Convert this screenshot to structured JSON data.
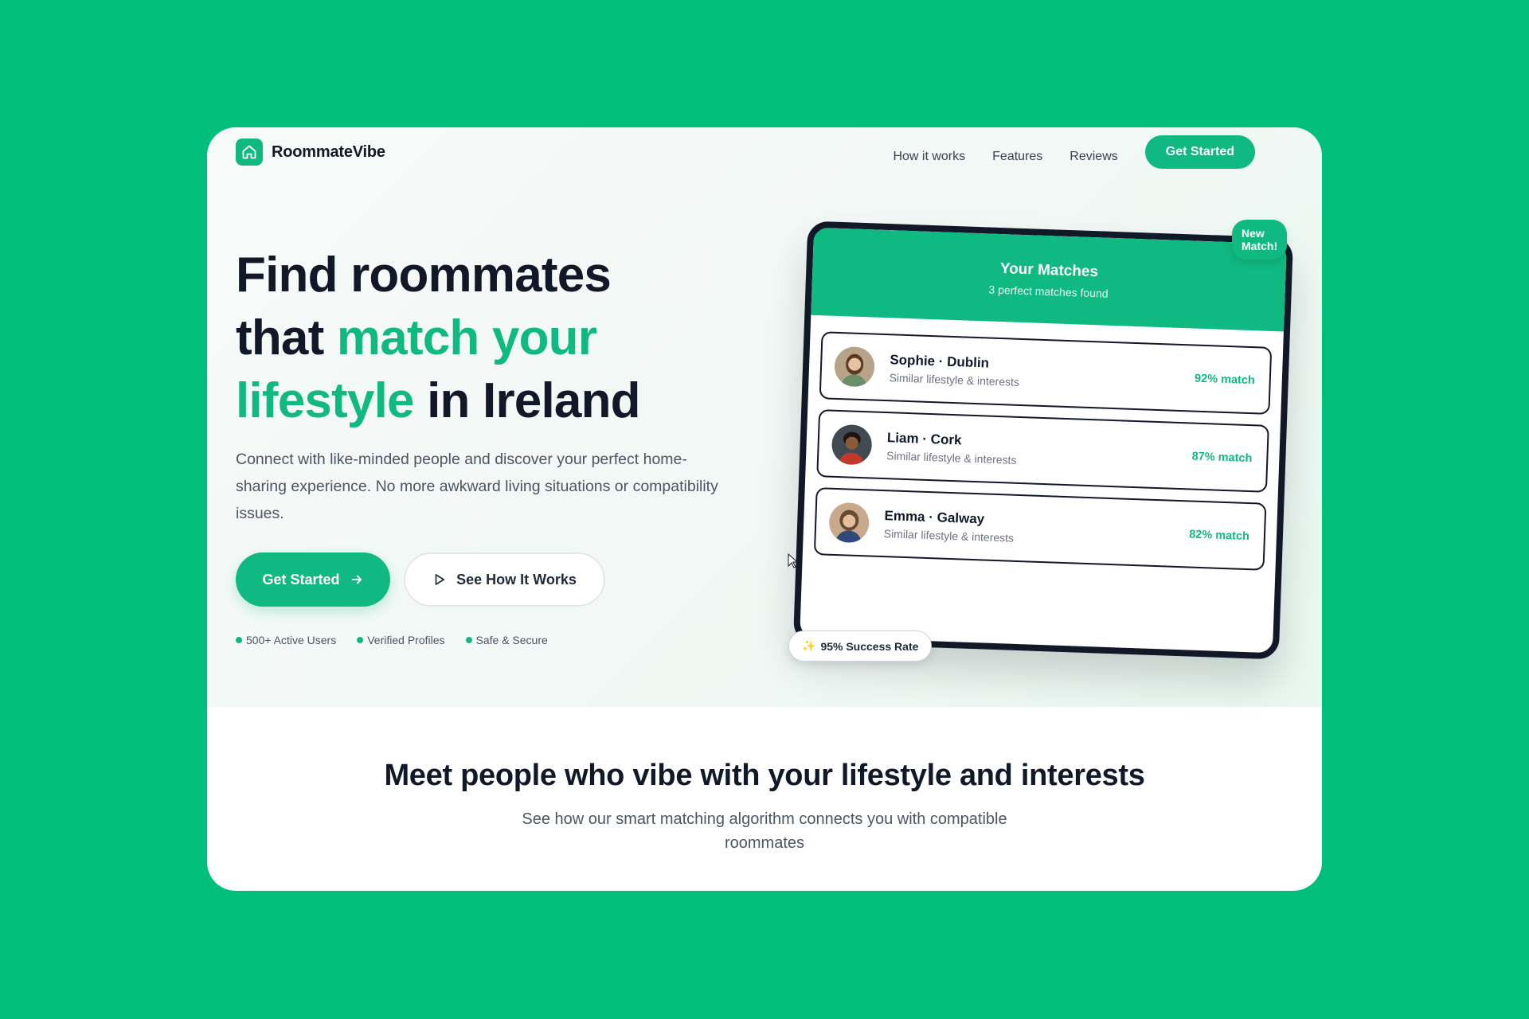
{
  "brand": {
    "name": "RoommateVibe",
    "logo_icon": "house-icon"
  },
  "nav": {
    "links": [
      "How it works",
      "Features",
      "Reviews"
    ],
    "cta": "Get Started"
  },
  "hero": {
    "headline_line1": "Find roommates",
    "headline_that": "that ",
    "headline_accent": "match your lifestyle",
    "headline_end": " in Ireland",
    "subtext": "Connect with like-minded people and discover your perfect home-sharing experience. No more awkward living situations or compatibility issues.",
    "primary_button": "Get Started",
    "primary_button_icon": "arrow-right-icon",
    "secondary_button": "See How It Works",
    "secondary_button_icon": "play-icon",
    "trust_items": [
      "500+ Active Users",
      "Verified Profiles",
      "Safe & Secure"
    ]
  },
  "mockup": {
    "title": "Your Matches",
    "subtitle": "3 perfect matches found",
    "new_badge": "New Match!",
    "success_badge": "95% Success Rate",
    "success_icon": "sparkle-icon",
    "matches": [
      {
        "name": "Sophie · Dublin",
        "desc": "Similar lifestyle & interests",
        "pct": "92% match"
      },
      {
        "name": "Liam · Cork",
        "desc": "Similar lifestyle & interests",
        "pct": "87% match"
      },
      {
        "name": "Emma · Galway",
        "desc": "Similar lifestyle & interests",
        "pct": "82% match"
      }
    ]
  },
  "section": {
    "title": "Meet people who vibe with your lifestyle and interests",
    "subtitle": "See how our smart matching algorithm connects you with compatible roommates"
  },
  "colors": {
    "background": "#00BF7D",
    "accent": "#10b981",
    "text_dark": "#111827",
    "text_muted": "#4b5563"
  }
}
